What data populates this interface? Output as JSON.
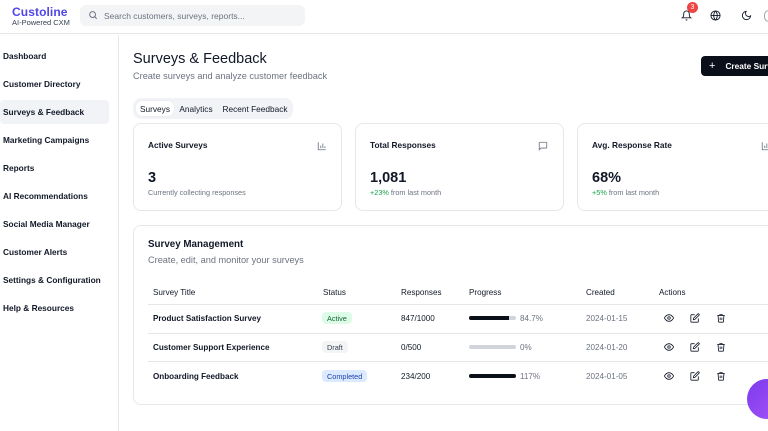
{
  "brand": {
    "name": "Custoline",
    "tagline": "AI-Powered CXM"
  },
  "search": {
    "placeholder": "Search customers, surveys, reports..."
  },
  "header": {
    "notification_count": "3"
  },
  "sidebar": {
    "items": [
      {
        "label": "Dashboard"
      },
      {
        "label": "Customer Directory"
      },
      {
        "label": "Surveys & Feedback"
      },
      {
        "label": "Marketing Campaigns"
      },
      {
        "label": "Reports"
      },
      {
        "label": "AI Recommendations"
      },
      {
        "label": "Social Media Manager"
      },
      {
        "label": "Customer Alerts"
      },
      {
        "label": "Settings & Configuration"
      },
      {
        "label": "Help & Resources"
      }
    ]
  },
  "page": {
    "title": "Surveys & Feedback",
    "subtitle": "Create surveys and analyze customer feedback",
    "create_button": "Create Surv"
  },
  "tabs": [
    {
      "label": "Surveys"
    },
    {
      "label": "Analytics"
    },
    {
      "label": "Recent Feedback"
    }
  ],
  "cards": [
    {
      "title": "Active Surveys",
      "value": "3",
      "delta": "",
      "note": "Currently collecting responses",
      "icon": "bar-chart-icon"
    },
    {
      "title": "Total Responses",
      "value": "1,081",
      "delta": "+23%",
      "note": " from last month",
      "icon": "message-square-icon"
    },
    {
      "title": "Avg. Response Rate",
      "value": "68%",
      "delta": "+5%",
      "note": " from last month",
      "icon": "bar-chart-icon"
    }
  ],
  "management": {
    "title": "Survey Management",
    "subtitle": "Create, edit, and monitor your surveys",
    "columns": [
      "Survey Title",
      "Status",
      "Responses",
      "Progress",
      "Created",
      "Actions"
    ],
    "rows": [
      {
        "title": "Product Satisfaction Survey",
        "status": "Active",
        "responses": "847/1000",
        "progress": 0.847,
        "progress_label": "84.7%",
        "created": "2024-01-15"
      },
      {
        "title": "Customer Support Experience",
        "status": "Draft",
        "responses": "0/500",
        "progress": 0,
        "progress_label": "0%",
        "created": "2024-01-20"
      },
      {
        "title": "Onboarding Feedback",
        "status": "Completed",
        "responses": "234/200",
        "progress": 1.0,
        "progress_label": "117%",
        "created": "2024-01-05"
      }
    ]
  },
  "colors": {
    "brand": "#4f46e5",
    "active_badge_bg": "#dcfce7",
    "active_badge_fg": "#166534",
    "draft_badge_bg": "#f3f4f6",
    "draft_badge_fg": "#374151",
    "completed_badge_bg": "#dbeafe",
    "completed_badge_fg": "#1e40af",
    "positive": "#16a34a"
  }
}
